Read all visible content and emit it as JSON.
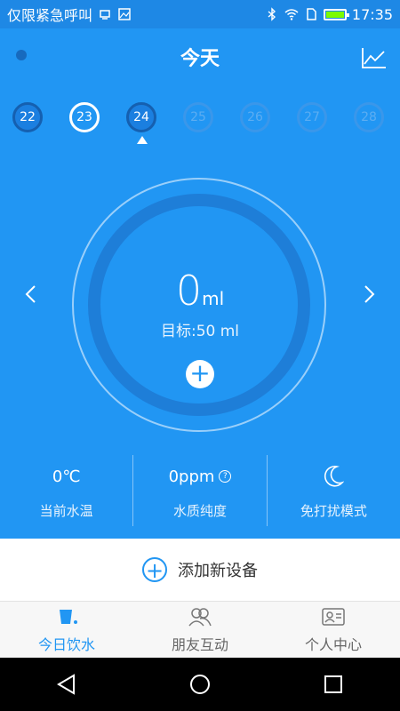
{
  "status_bar": {
    "left_text": "仅限紧急呼叫",
    "time": "17:35"
  },
  "header": {
    "title": "今天"
  },
  "dates": [
    {
      "day": "22",
      "state": "past"
    },
    {
      "day": "23",
      "state": "today"
    },
    {
      "day": "24",
      "state": "past"
    },
    {
      "day": "25",
      "state": "future"
    },
    {
      "day": "26",
      "state": "future"
    },
    {
      "day": "27",
      "state": "future"
    },
    {
      "day": "28",
      "state": "future"
    }
  ],
  "intake": {
    "amount": "0",
    "unit": "ml",
    "goal": "目标:50 ml"
  },
  "stats": {
    "temperature": {
      "value": "0℃",
      "label": "当前水温"
    },
    "purity": {
      "value": "0ppm",
      "label": "水质纯度"
    },
    "mode": {
      "label": "免打扰模式"
    }
  },
  "add_device": {
    "label": "添加新设备"
  },
  "tabs": [
    {
      "label": "今日饮水",
      "icon": "water-cup-icon",
      "active": true
    },
    {
      "label": "朋友互动",
      "icon": "friends-icon",
      "active": false
    },
    {
      "label": "个人中心",
      "icon": "profile-card-icon",
      "active": false
    }
  ],
  "colors": {
    "primary": "#2196F3",
    "ring": "#1E7ED8"
  }
}
